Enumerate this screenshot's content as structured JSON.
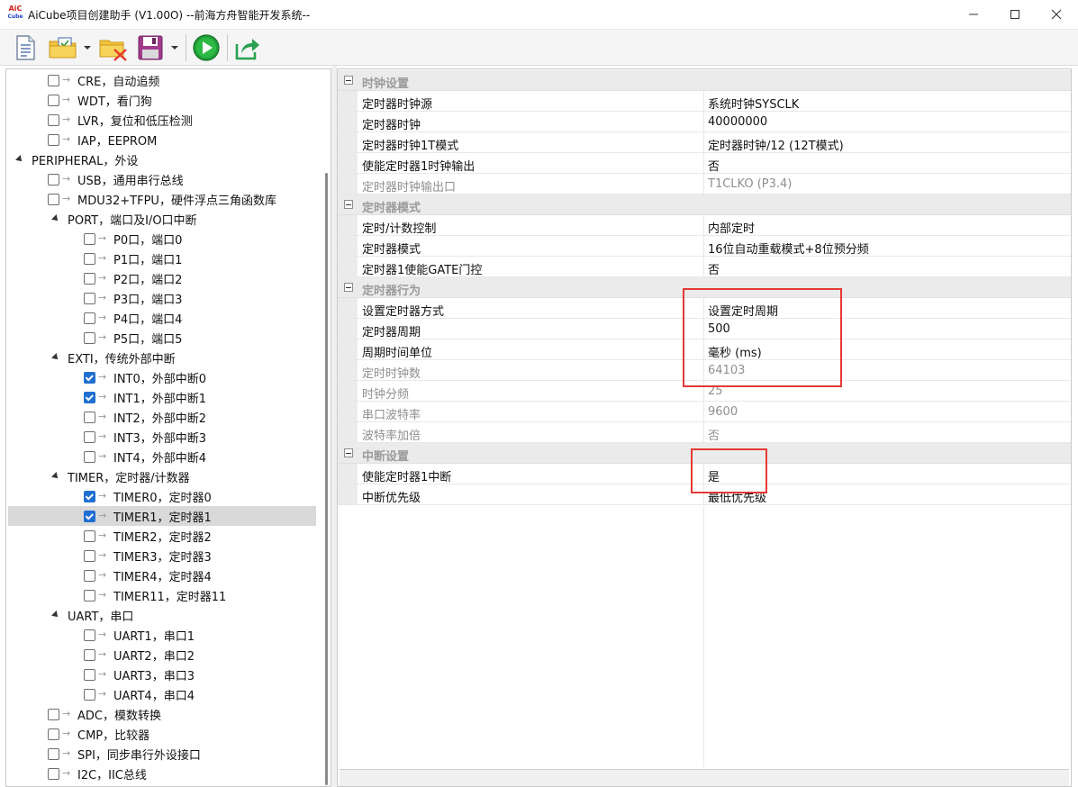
{
  "window": {
    "title": "AiCube项目创建助手 (V1.00O) --前海方舟智能开发系统--",
    "icon_text_top": "AiC",
    "icon_text_bottom": "Cube",
    "controls": [
      "minimize-icon",
      "maximize-icon",
      "close-icon"
    ]
  },
  "toolbar": {
    "buttons": [
      {
        "icon": "new-document-icon"
      },
      {
        "icon": "open-folder-icon",
        "has_dropdown": true
      },
      {
        "icon": "close-folder-icon"
      },
      {
        "icon": "save-icon",
        "has_dropdown": true
      },
      {
        "icon": "run-icon"
      },
      {
        "icon": "export-icon"
      }
    ]
  },
  "tree": {
    "items": [
      {
        "label": "CRE，自动追频",
        "level": 2,
        "checkbox": true,
        "checked": false
      },
      {
        "label": "WDT，看门狗",
        "level": 2,
        "checkbox": true,
        "checked": false
      },
      {
        "label": "LVR，复位和低压检测",
        "level": 2,
        "checkbox": true,
        "checked": false
      },
      {
        "label": "IAP，EEPROM",
        "level": 2,
        "checkbox": true,
        "checked": false
      },
      {
        "label": "PERIPHERAL，外设",
        "level": 0,
        "expander": true
      },
      {
        "label": "USB，通用串行总线",
        "level": 2,
        "checkbox": true,
        "checked": false
      },
      {
        "label": "MDU32+TFPU，硬件浮点三角函数库",
        "level": 2,
        "checkbox": true,
        "checked": false
      },
      {
        "label": "PORT，端口及I/O口中断",
        "level": 1,
        "expander": true
      },
      {
        "label": "P0口，端口0",
        "level": 3,
        "checkbox": true,
        "checked": false
      },
      {
        "label": "P1口，端口1",
        "level": 3,
        "checkbox": true,
        "checked": false
      },
      {
        "label": "P2口，端口2",
        "level": 3,
        "checkbox": true,
        "checked": false
      },
      {
        "label": "P3口，端口3",
        "level": 3,
        "checkbox": true,
        "checked": false
      },
      {
        "label": "P4口，端口4",
        "level": 3,
        "checkbox": true,
        "checked": false
      },
      {
        "label": "P5口，端口5",
        "level": 3,
        "checkbox": true,
        "checked": false
      },
      {
        "label": "EXTI，传统外部中断",
        "level": 1,
        "expander": true
      },
      {
        "label": "INT0，外部中断0",
        "level": 3,
        "checkbox": true,
        "checked": true
      },
      {
        "label": "INT1，外部中断1",
        "level": 3,
        "checkbox": true,
        "checked": true
      },
      {
        "label": "INT2，外部中断2",
        "level": 3,
        "checkbox": true,
        "checked": false
      },
      {
        "label": "INT3，外部中断3",
        "level": 3,
        "checkbox": true,
        "checked": false
      },
      {
        "label": "INT4，外部中断4",
        "level": 3,
        "checkbox": true,
        "checked": false
      },
      {
        "label": "TIMER，定时器/计数器",
        "level": 1,
        "expander": true
      },
      {
        "label": "TIMER0，定时器0",
        "level": 3,
        "checkbox": true,
        "checked": true
      },
      {
        "label": "TIMER1，定时器1",
        "level": 3,
        "checkbox": true,
        "checked": true,
        "selected": true
      },
      {
        "label": "TIMER2，定时器2",
        "level": 3,
        "checkbox": true,
        "checked": false
      },
      {
        "label": "TIMER3，定时器3",
        "level": 3,
        "checkbox": true,
        "checked": false
      },
      {
        "label": "TIMER4，定时器4",
        "level": 3,
        "checkbox": true,
        "checked": false
      },
      {
        "label": "TIMER11，定时器11",
        "level": 3,
        "checkbox": true,
        "checked": false
      },
      {
        "label": "UART，串口",
        "level": 1,
        "expander": true
      },
      {
        "label": "UART1，串口1",
        "level": 3,
        "checkbox": true,
        "checked": false
      },
      {
        "label": "UART2，串口2",
        "level": 3,
        "checkbox": true,
        "checked": false
      },
      {
        "label": "UART3，串口3",
        "level": 3,
        "checkbox": true,
        "checked": false
      },
      {
        "label": "UART4，串口4",
        "level": 3,
        "checkbox": true,
        "checked": false
      },
      {
        "label": "ADC，模数转换",
        "level": 2,
        "checkbox": true,
        "checked": false
      },
      {
        "label": "CMP，比较器",
        "level": 2,
        "checkbox": true,
        "checked": false
      },
      {
        "label": "SPI，同步串行外设接口",
        "level": 2,
        "checkbox": true,
        "checked": false
      },
      {
        "label": "I2C，IIC总线",
        "level": 2,
        "checkbox": true,
        "checked": false
      }
    ]
  },
  "properties": {
    "rows": [
      {
        "type": "category",
        "label": "时钟设置"
      },
      {
        "type": "prop",
        "name": "定时器时钟源",
        "value": "系统时钟SYSCLK",
        "disabled": false
      },
      {
        "type": "prop",
        "name": "定时器时钟",
        "value": "40000000",
        "disabled": false
      },
      {
        "type": "prop",
        "name": "定时器时钟1T模式",
        "value": "定时器时钟/12 (12T模式)",
        "disabled": false
      },
      {
        "type": "prop",
        "name": "使能定时器1时钟输出",
        "value": "否",
        "disabled": false
      },
      {
        "type": "prop",
        "name": "定时器时钟输出口",
        "value": "T1CLKO (P3.4)",
        "disabled": true
      },
      {
        "type": "category",
        "label": "定时器模式"
      },
      {
        "type": "prop",
        "name": "定时/计数控制",
        "value": "内部定时",
        "disabled": false
      },
      {
        "type": "prop",
        "name": "定时器模式",
        "value": "16位自动重载模式+8位预分频",
        "disabled": false
      },
      {
        "type": "prop",
        "name": "定时器1使能GATE门控",
        "value": "否",
        "disabled": false
      },
      {
        "type": "category",
        "label": "定时器行为"
      },
      {
        "type": "prop",
        "name": "设置定时器方式",
        "value": "设置定时周期",
        "disabled": false
      },
      {
        "type": "prop",
        "name": "定时器周期",
        "value": "500",
        "disabled": false
      },
      {
        "type": "prop",
        "name": "周期时间单位",
        "value": "毫秒 (ms)",
        "disabled": false
      },
      {
        "type": "prop",
        "name": "定时时钟数",
        "value": "64103",
        "disabled": true
      },
      {
        "type": "prop",
        "name": "时钟分频",
        "value": "25",
        "disabled": true
      },
      {
        "type": "prop",
        "name": "串口波特率",
        "value": "9600",
        "disabled": true
      },
      {
        "type": "prop",
        "name": "波特率加倍",
        "value": "否",
        "disabled": true
      },
      {
        "type": "category",
        "label": "中断设置"
      },
      {
        "type": "prop",
        "name": "使能定时器1中断",
        "value": "是",
        "disabled": false
      },
      {
        "type": "prop",
        "name": "中断优先级",
        "value": "最低优先级",
        "disabled": false
      }
    ]
  },
  "colors": {
    "annotation_red": "#e53935",
    "check_blue": "#1f6fd1",
    "category_bg": "#ebebeb",
    "selected_row": "#d9d9d9"
  }
}
